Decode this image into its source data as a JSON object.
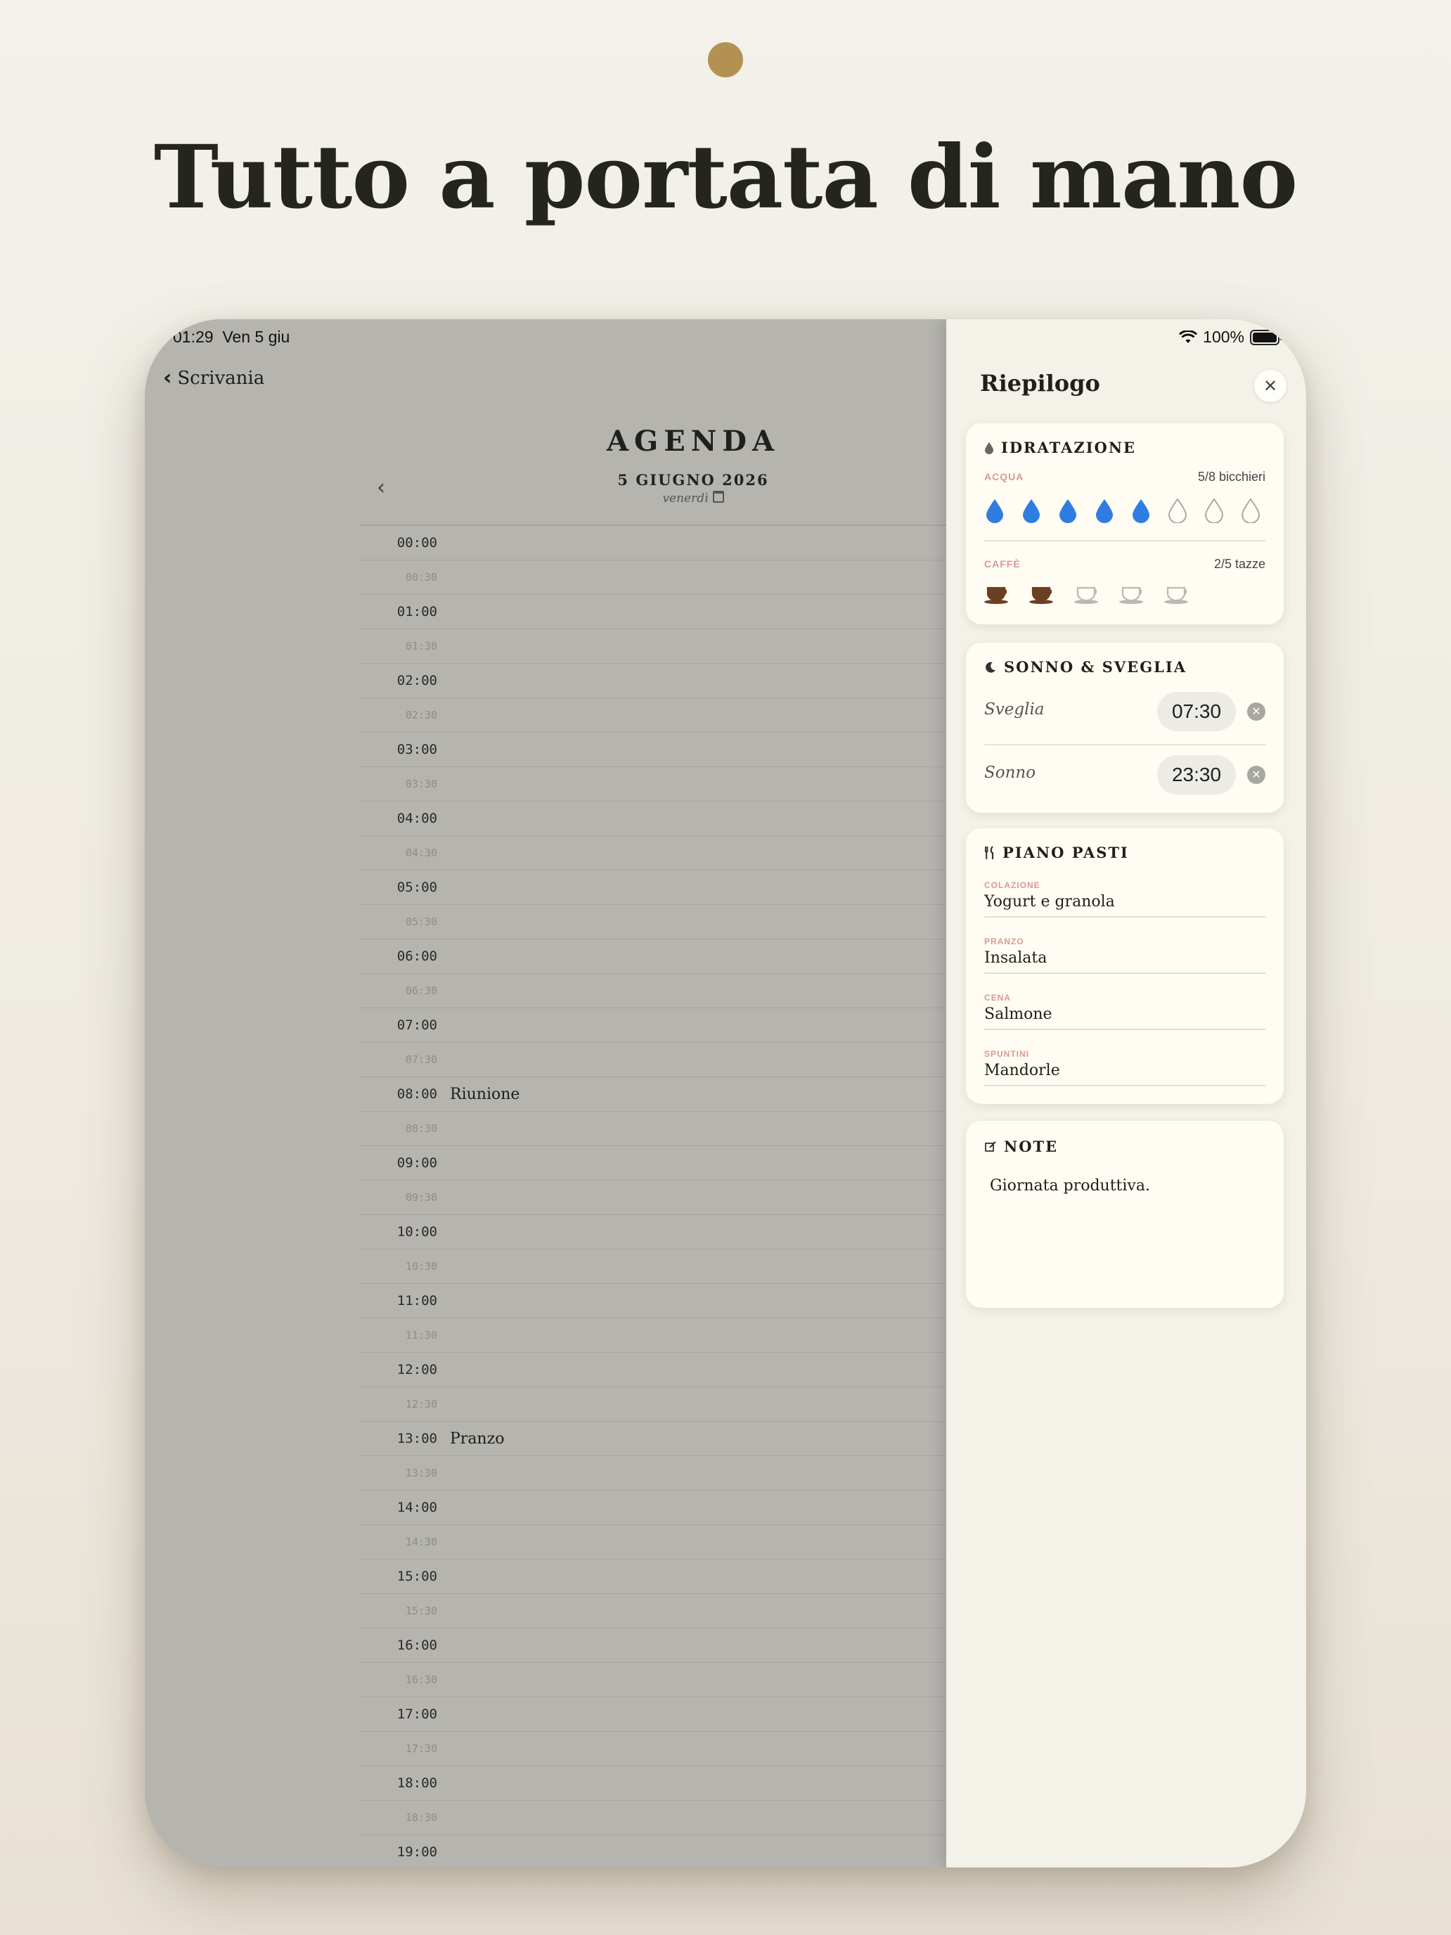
{
  "headline": "Tutto a portata di mano",
  "status": {
    "time": "01:29",
    "date": "Ven 5 giu",
    "battery": "100%"
  },
  "nav": {
    "back_label": "Scrivania"
  },
  "agenda": {
    "title": "AGENDA",
    "date": "5 GIUGNO 2026",
    "weekday": "venerdì",
    "slots": [
      {
        "time": "00:00",
        "kind": "hour",
        "event": ""
      },
      {
        "time": "00:30",
        "kind": "half",
        "event": ""
      },
      {
        "time": "01:00",
        "kind": "hour",
        "event": ""
      },
      {
        "time": "01:30",
        "kind": "half",
        "event": ""
      },
      {
        "time": "02:00",
        "kind": "hour",
        "event": ""
      },
      {
        "time": "02:30",
        "kind": "half",
        "event": ""
      },
      {
        "time": "03:00",
        "kind": "hour",
        "event": ""
      },
      {
        "time": "03:30",
        "kind": "half",
        "event": ""
      },
      {
        "time": "04:00",
        "kind": "hour",
        "event": ""
      },
      {
        "time": "04:30",
        "kind": "half",
        "event": ""
      },
      {
        "time": "05:00",
        "kind": "hour",
        "event": ""
      },
      {
        "time": "05:30",
        "kind": "half",
        "event": ""
      },
      {
        "time": "06:00",
        "kind": "hour",
        "event": ""
      },
      {
        "time": "06:30",
        "kind": "half",
        "event": ""
      },
      {
        "time": "07:00",
        "kind": "hour",
        "event": ""
      },
      {
        "time": "07:30",
        "kind": "half",
        "event": ""
      },
      {
        "time": "08:00",
        "kind": "hour",
        "event": "Riunione"
      },
      {
        "time": "08:30",
        "kind": "half",
        "event": ""
      },
      {
        "time": "09:00",
        "kind": "hour",
        "event": ""
      },
      {
        "time": "09:30",
        "kind": "half",
        "event": ""
      },
      {
        "time": "10:00",
        "kind": "hour",
        "event": ""
      },
      {
        "time": "10:30",
        "kind": "half",
        "event": ""
      },
      {
        "time": "11:00",
        "kind": "hour",
        "event": ""
      },
      {
        "time": "11:30",
        "kind": "half",
        "event": ""
      },
      {
        "time": "12:00",
        "kind": "hour",
        "event": ""
      },
      {
        "time": "12:30",
        "kind": "half",
        "event": ""
      },
      {
        "time": "13:00",
        "kind": "hour",
        "event": "Pranzo"
      },
      {
        "time": "13:30",
        "kind": "half",
        "event": ""
      },
      {
        "time": "14:00",
        "kind": "hour",
        "event": ""
      },
      {
        "time": "14:30",
        "kind": "half",
        "event": ""
      },
      {
        "time": "15:00",
        "kind": "hour",
        "event": ""
      },
      {
        "time": "15:30",
        "kind": "half",
        "event": ""
      },
      {
        "time": "16:00",
        "kind": "hour",
        "event": ""
      },
      {
        "time": "16:30",
        "kind": "half",
        "event": ""
      },
      {
        "time": "17:00",
        "kind": "hour",
        "event": ""
      },
      {
        "time": "17:30",
        "kind": "half",
        "event": ""
      },
      {
        "time": "18:00",
        "kind": "hour",
        "event": ""
      },
      {
        "time": "18:30",
        "kind": "half",
        "event": ""
      },
      {
        "time": "19:00",
        "kind": "hour",
        "event": ""
      }
    ]
  },
  "summary": {
    "title": "Riepilogo",
    "hydration": {
      "heading": "IDRATAZIONE",
      "water_label": "ACQUA",
      "water_count": "5/8 bicchieri",
      "water_filled": 5,
      "water_total": 8,
      "coffee_label": "CAFFÈ",
      "coffee_count": "2/5 tazze",
      "coffee_filled": 2,
      "coffee_total": 5
    },
    "sleep": {
      "heading": "SONNO & SVEGLIA",
      "wake_label": "Sveglia",
      "wake_time": "07:30",
      "sleep_label": "Sonno",
      "sleep_time": "23:30"
    },
    "meals": {
      "heading": "PIANO PASTI",
      "items": [
        {
          "label": "COLAZIONE",
          "value": "Yogurt e granola"
        },
        {
          "label": "PRANZO",
          "value": "Insalata"
        },
        {
          "label": "CENA",
          "value": "Salmone"
        },
        {
          "label": "SPUNTINI",
          "value": "Mandorle"
        }
      ]
    },
    "notes": {
      "heading": "NOTE",
      "text": "Giornata produttiva."
    }
  },
  "colors": {
    "accent": "#b39150",
    "water": "#2f7de0",
    "coffee": "#6b3f22",
    "label": "#d89a96"
  },
  "icons": [
    "wifi-icon",
    "battery-icon",
    "chevron-left-icon",
    "calendar-icon",
    "close-icon",
    "drop-icon",
    "moon-icon",
    "utensils-icon",
    "note-edit-icon",
    "coffee-cup-icon",
    "clear-icon"
  ]
}
